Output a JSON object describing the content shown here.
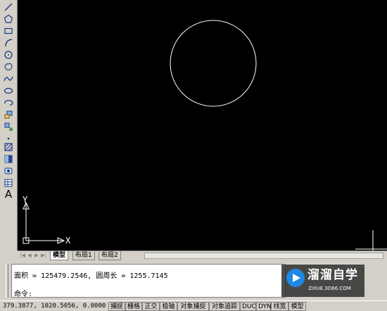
{
  "toolbar": {
    "tools": [
      {
        "name": "line",
        "icon": "line-tool-icon"
      },
      {
        "name": "polygon",
        "icon": "polygon-tool-icon"
      },
      {
        "name": "rectangle",
        "icon": "rectangle-tool-icon"
      },
      {
        "name": "arc",
        "icon": "arc-tool-icon"
      },
      {
        "name": "circle",
        "icon": "circle-tool-icon"
      },
      {
        "name": "revision-cloud",
        "icon": "revcloud-tool-icon"
      },
      {
        "name": "spline",
        "icon": "spline-tool-icon"
      },
      {
        "name": "ellipse",
        "icon": "ellipse-tool-icon"
      },
      {
        "name": "ellipse-arc",
        "icon": "ellipse-arc-tool-icon"
      },
      {
        "name": "insert-block",
        "icon": "insert-block-tool-icon"
      },
      {
        "name": "make-block",
        "icon": "make-block-tool-icon"
      },
      {
        "name": "point",
        "icon": "point-tool-icon"
      },
      {
        "name": "hatch",
        "icon": "hatch-tool-icon"
      },
      {
        "name": "gradient",
        "icon": "gradient-tool-icon"
      },
      {
        "name": "region",
        "icon": "region-tool-icon"
      },
      {
        "name": "table",
        "icon": "table-tool-icon"
      },
      {
        "name": "multiline-text",
        "icon": "text-tool-icon",
        "glyph": "A"
      }
    ]
  },
  "canvas": {
    "background": "#000000",
    "ucs": {
      "x_label": "X",
      "y_label": "Y"
    }
  },
  "tabs": {
    "items": [
      {
        "label": "模型",
        "active": true
      },
      {
        "label": "布局1",
        "active": false
      },
      {
        "label": "布局2",
        "active": false
      }
    ]
  },
  "command": {
    "history": "面积 = 125479.2546, 圆周长 = 1255.7145",
    "prompt": "命令:",
    "input_value": ""
  },
  "watermark": {
    "title": "溜溜自学",
    "url": "ZIXUE.3D66.COM"
  },
  "status": {
    "coords": "379.3877,    1020.5056, 0.0000",
    "buttons": [
      "捕捉",
      "栅格",
      "正交",
      "极轴",
      "对象捕捉",
      "对象追踪",
      "DUCS",
      "DYN",
      "线宽",
      "模型"
    ]
  },
  "colors": {
    "canvas": "#000000",
    "entity": "#ffffff",
    "chrome": "#d4d0c8",
    "watermark_accent": "#1e88e5"
  }
}
